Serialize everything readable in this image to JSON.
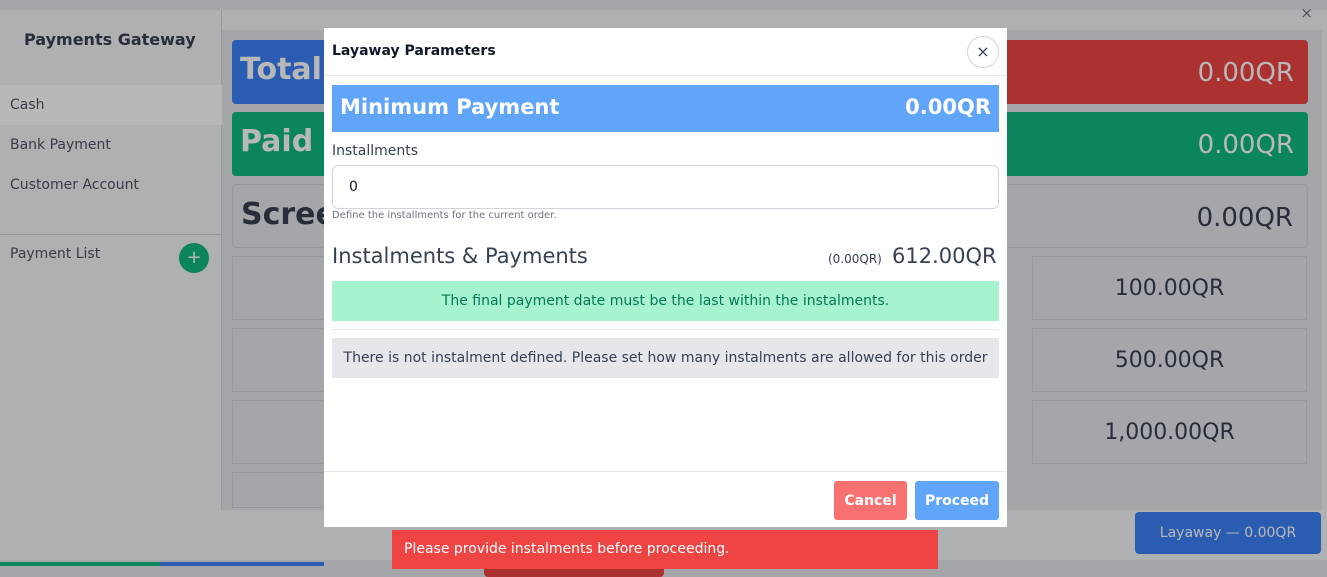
{
  "background": {
    "title": "Payments Gateway",
    "menu": [
      "Cash",
      "Bank Payment",
      "Customer Account"
    ],
    "payment_list_label": "Payment List",
    "plus_symbol": "+",
    "total_label": "Total",
    "total_value": "0.00QR",
    "paid_label": "Paid",
    "paid_value": "0.00QR",
    "screen_label": "Screen",
    "screen_value": "0.00QR",
    "keys": [
      "100.00QR",
      "500.00QR",
      "1,000.00QR"
    ],
    "layaway_button": "Layaway — 0.00QR",
    "close_symbol": "×"
  },
  "modal": {
    "title": "Layaway Parameters",
    "close_symbol": "×",
    "minimum_payment_label": "Minimum Payment",
    "minimum_payment_value": "0.00QR",
    "installments_label": "Installments",
    "installments_value": "0",
    "installments_help": "Define the installments for the current order.",
    "instalments_title": "Instalments & Payments",
    "instalments_paid": "(0.00QR)",
    "instalments_total": "612.00QR",
    "info_message": "The final payment date must be the last within the instalments.",
    "empty_message": "There is not instalment defined. Please set how many instalments are allowed for this order",
    "cancel_label": "Cancel",
    "proceed_label": "Proceed"
  },
  "toast": {
    "message": "Please provide instalments before proceeding."
  },
  "colors": {
    "primary": "#60a5fa",
    "danger": "#ef4444",
    "success_bg": "#a7f3d0",
    "success_text": "#047857"
  }
}
